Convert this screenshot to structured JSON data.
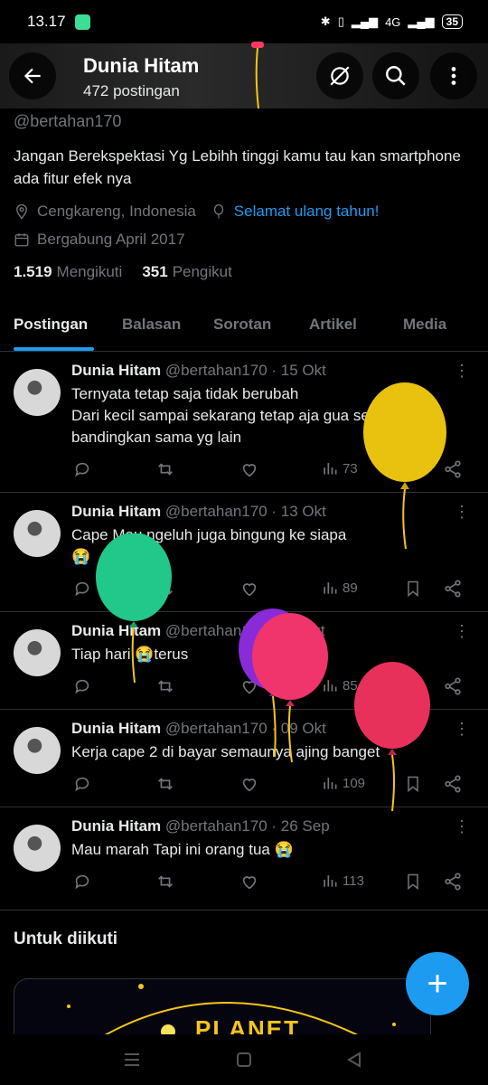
{
  "status_bar": {
    "time": "13.17",
    "signal_label": "4G",
    "battery": "35"
  },
  "header": {
    "title": "Dunia Hitam",
    "subtitle": "472 postingan"
  },
  "profile": {
    "handle": "@bertahan170",
    "bio": "Jangan Berekspektasi Yg Lebihh tinggi  kamu tau kan smartphone ada fitur efek nya",
    "location": "Cengkareng, Indonesia",
    "birthday_link": "Selamat ulang tahun!",
    "joined": "Bergabung April 2017",
    "following_count": "1.519",
    "following_label": "Mengikuti",
    "followers_count": "351",
    "followers_label": "Pengikut"
  },
  "tabs": [
    {
      "label": "Postingan"
    },
    {
      "label": "Balasan"
    },
    {
      "label": "Sorotan"
    },
    {
      "label": "Artikel"
    },
    {
      "label": "Media"
    }
  ],
  "tweets": [
    {
      "name": "Dunia Hitam",
      "handle": "@bertahan170",
      "date": "· 15 Okt",
      "text": "Ternyata tetap saja tidak berubah\nDari kecil sampai sekarang tetap aja gua selalu di bandingkan sama yg lain",
      "views": "73"
    },
    {
      "name": "Dunia Hitam",
      "handle": "@bertahan170",
      "date": "· 13 Okt",
      "text": "Cape Mau ngeluh juga bingung ke siapa\n😭",
      "views": "89"
    },
    {
      "name": "Dunia Hitam",
      "handle": "@bertahan170",
      "date": "· 11 Okt",
      "text": "Tiap hari 😭terus",
      "views": "85"
    },
    {
      "name": "Dunia Hitam",
      "handle": "@bertahan170",
      "date": "· 09 Okt",
      "text": "Kerja cape 2 di bayar semaunya ajing banget",
      "views": "109"
    },
    {
      "name": "Dunia Hitam",
      "handle": "@bertahan170",
      "date": "· 26 Sep",
      "text": "Mau marah Tapi ini orang tua 😭",
      "views": "113"
    }
  ],
  "suggestions": {
    "title": "Untuk diikuti",
    "card_text": "PLANET"
  },
  "fab": {
    "label": "+"
  },
  "colors": {
    "accent": "#1d9bf0",
    "background": "#000000",
    "muted": "#71767b"
  }
}
